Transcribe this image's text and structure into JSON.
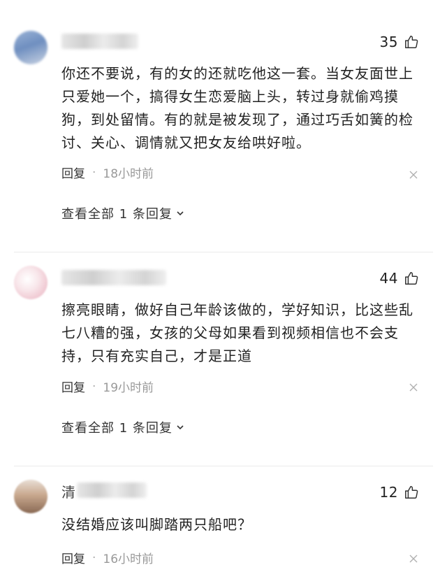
{
  "comments": [
    {
      "likes": "35",
      "text": "你还不要说，有的女的还就吃他这一套。当女友面世上只爱她一个，搞得女生恋爱脑上头，转过身就偷鸡摸狗，到处留情。有的就是被发现了，通过巧舌如簧的检讨、关心、调情就又把女友给哄好啦。",
      "reply_label": "回复",
      "separator": "·",
      "time": "18小时前",
      "view_replies": "查看全部 1 条回复"
    },
    {
      "likes": "44",
      "text": "擦亮眼睛，做好自己年龄该做的，学好知识，比这些乱七八糟的强，女孩的父母如果看到视频相信也不会支持，只有充实自己，才是正道",
      "reply_label": "回复",
      "separator": "·",
      "time": "19小时前",
      "view_replies": "查看全部 1 条回复"
    },
    {
      "username_partial": "清",
      "likes": "12",
      "text": "没结婚应该叫脚踏两只船吧？",
      "reply_label": "回复",
      "separator": "·",
      "time": "16小时前"
    }
  ],
  "icons": {
    "like": "thumbs-up-icon",
    "more": "close-icon",
    "expand": "chevron-down-icon"
  },
  "colors": {
    "text": "#222222",
    "meta": "#999999",
    "divider": "#ebebeb"
  }
}
